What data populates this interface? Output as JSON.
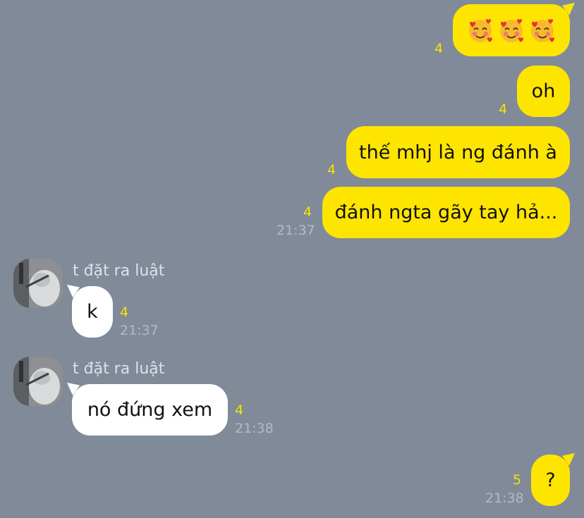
{
  "conversation": {
    "sender_name": "t đặt ra luật",
    "messages": [
      {
        "id": "m1",
        "direction": "outgoing",
        "type": "emoji",
        "emoji": [
          "smiling-face-with-hearts-icon",
          "smiling-face-with-hearts-icon",
          "smiling-face-with-hearts-icon"
        ],
        "unread": "4"
      },
      {
        "id": "m2",
        "direction": "outgoing",
        "text": "oh",
        "unread": "4"
      },
      {
        "id": "m3",
        "direction": "outgoing",
        "text": "thế mhj là ng đánh à",
        "unread": "4"
      },
      {
        "id": "m4",
        "direction": "outgoing",
        "text": "đánh ngta gãy tay hả...",
        "unread": "4",
        "time": "21:37"
      },
      {
        "id": "m5",
        "direction": "incoming",
        "text": "k",
        "unread": "4",
        "time": "21:37"
      },
      {
        "id": "m6",
        "direction": "incoming",
        "text": "nó đứng xem",
        "unread": "4",
        "time": "21:38"
      },
      {
        "id": "m7",
        "direction": "outgoing",
        "text": "?",
        "unread": "5",
        "time": "21:38"
      }
    ]
  },
  "colors": {
    "background": "#808a99",
    "outgoing_bubble": "#fee500",
    "incoming_bubble": "#ffffff",
    "unread_count": "#f7e300",
    "timestamp": "#b3bac4"
  }
}
